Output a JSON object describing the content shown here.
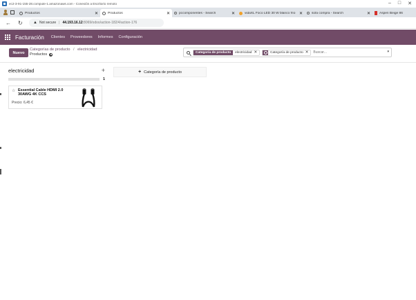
{
  "rdp": {
    "title": "ec2-3-91-155-28.compute-1.amazonaws.com - Conexión a Escritorio remoto",
    "minimize": "–",
    "maximize": "□",
    "close": "✕"
  },
  "browser": {
    "tabs": [
      {
        "label": "Productos",
        "icon": "odoo-icon",
        "active": false
      },
      {
        "label": "Productos",
        "icon": "odoo-icon",
        "active": true
      },
      {
        "label": "pccomponentes - Search",
        "icon": "search-icon",
        "active": false
      },
      {
        "label": "vidaXL Foco LED 30 W blanco frío",
        "icon": "vidaxl-icon",
        "active": false
      },
      {
        "label": "sofa compra - Search",
        "icon": "search-icon",
        "active": false
      },
      {
        "label": "Aspen Beige 86",
        "icon": "aspen-icon",
        "active": false
      }
    ],
    "tab_close": "✕",
    "address": {
      "security": "Not secure",
      "host": "44.193.16.12",
      "path": ":8069/odoo/action-182/4/action-176"
    }
  },
  "odoo": {
    "app_name": "Facturación",
    "menu": [
      "Clientes",
      "Proveedores",
      "Informes",
      "Configuración"
    ]
  },
  "control_panel": {
    "new_button": "Nuevo",
    "breadcrumb": {
      "parent": "Categorías de producto",
      "separator": "/",
      "current": "electricidad",
      "sub": "Productos"
    },
    "search": {
      "facets": [
        {
          "label": "Categoría de producto",
          "value": "electricidad",
          "type": "text"
        },
        {
          "label": "",
          "value": "Categoría de producto",
          "type": "group"
        }
      ],
      "remove": "✕",
      "placeholder": "Buscar...",
      "dropdown": "▾"
    }
  },
  "kanban": {
    "column": {
      "title": "electricidad",
      "add": "+",
      "count": "1",
      "progress": 0
    },
    "cards": [
      {
        "name": "Essential Cable HDMI 2.0 30AWG 4K CCS",
        "price": "Precio: 6,45 €",
        "favorite_icon": "☆"
      }
    ],
    "add_category": {
      "plus": "+",
      "label": "Categoría de producto"
    }
  },
  "colors": {
    "brand": "#714b67",
    "tab_strip": "#dfe3e8"
  }
}
